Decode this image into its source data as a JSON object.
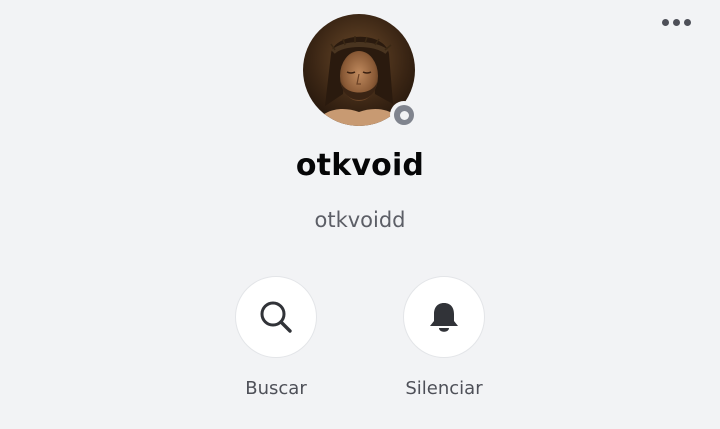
{
  "header": {
    "more_icon": "ellipsis-horizontal-icon"
  },
  "profile": {
    "display_name": "otkvoid",
    "username": "otkvoidd",
    "status": "offline",
    "status_color": "#80848e"
  },
  "actions": [
    {
      "label": "Buscar",
      "icon": "search-icon"
    },
    {
      "label": "Silenciar",
      "icon": "bell-icon"
    }
  ],
  "colors": {
    "background": "#f2f3f5",
    "text_primary": "#060607",
    "text_secondary": "#5c5e66",
    "icon": "#313338"
  }
}
